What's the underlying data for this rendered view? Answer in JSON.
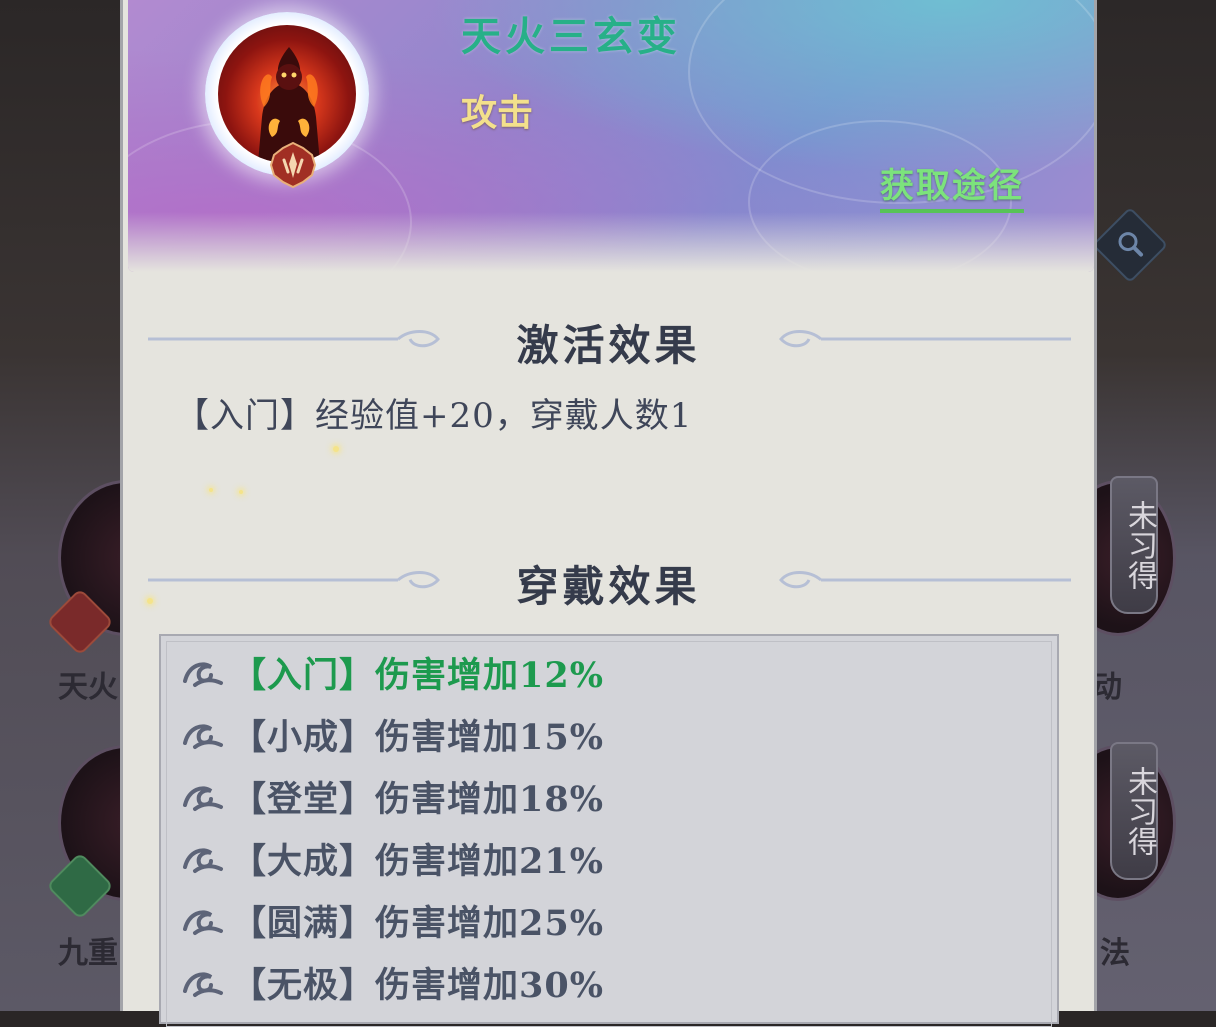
{
  "background": {
    "left_labels": [
      "天火",
      "九重"
    ],
    "right_labels": [
      "动",
      "法"
    ],
    "right_tags": [
      "未习得",
      "未习得"
    ]
  },
  "header": {
    "skill_name": "天火三玄变",
    "skill_type": "攻击",
    "acquire_link": "获取途径"
  },
  "activation": {
    "title": "激活效果",
    "text": "【入门】经验值+20，穿戴人数1"
  },
  "wear": {
    "title": "穿戴效果",
    "effects": [
      {
        "text": "【入门】伤害增加12%",
        "active": true
      },
      {
        "text": "【小成】伤害增加15%",
        "active": false
      },
      {
        "text": "【登堂】伤害增加18%",
        "active": false
      },
      {
        "text": "【大成】伤害增加21%",
        "active": false
      },
      {
        "text": "【圆满】伤害增加25%",
        "active": false
      },
      {
        "text": "【无极】伤害增加30%",
        "active": false
      }
    ]
  },
  "colors": {
    "skill_name": "#27b088",
    "skill_type": "#f3e08c",
    "acquire_link": "#7ce37c",
    "active_effect": "#1d9a4e",
    "inactive_effect": "#4a5366"
  },
  "icons": [
    "search-icon",
    "rank-badge-icon",
    "cloud-bullet-icon",
    "avatar-fire-figure"
  ]
}
